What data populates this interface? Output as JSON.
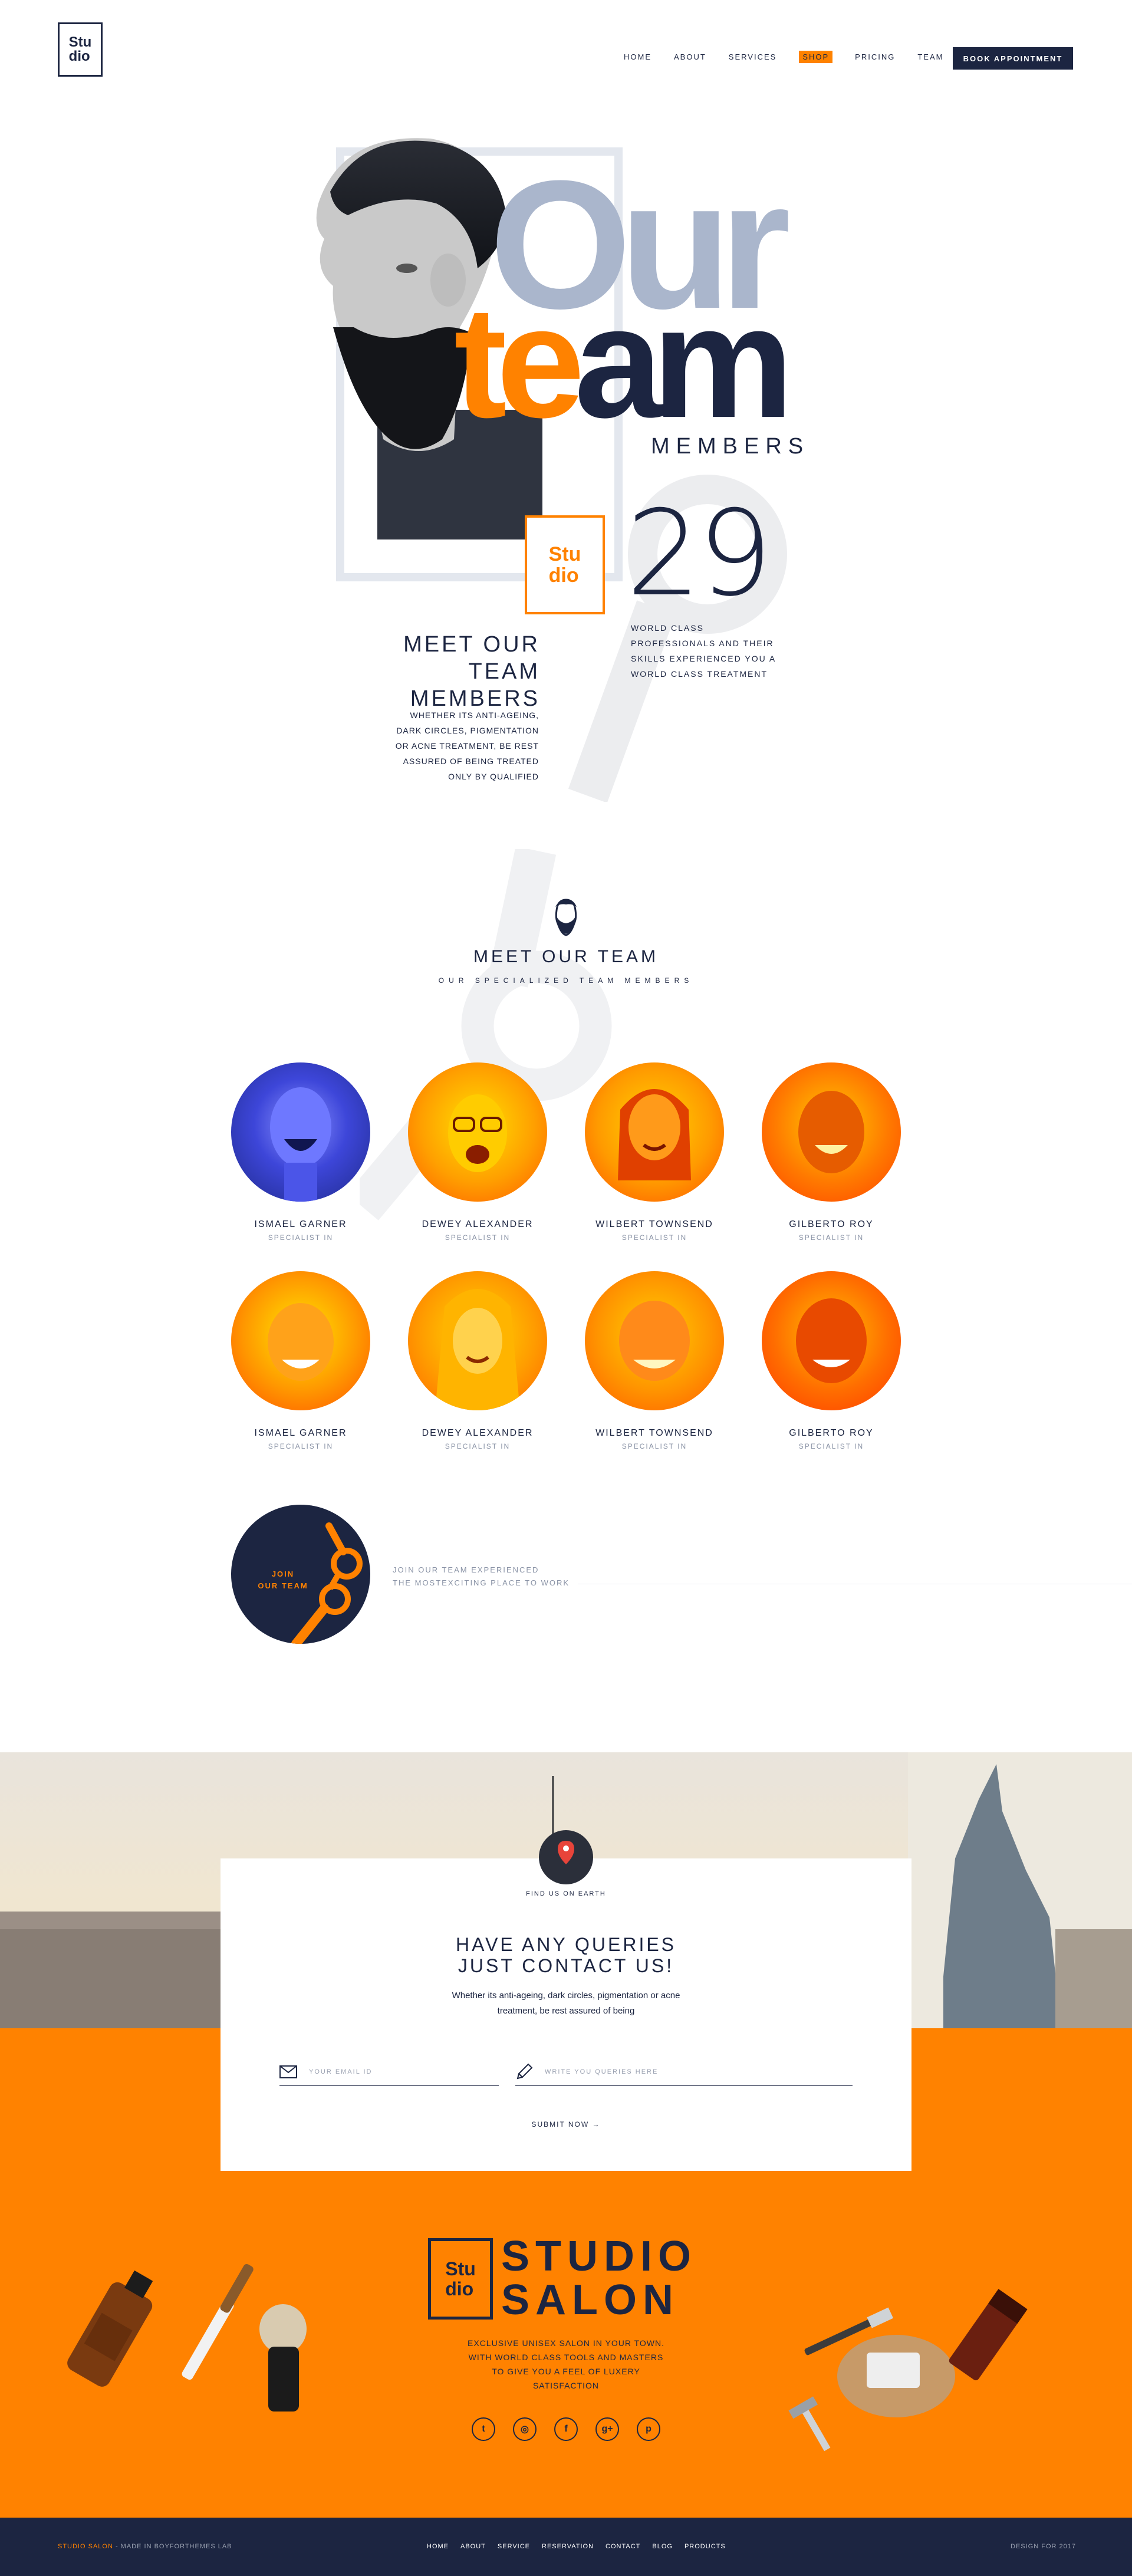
{
  "header": {
    "logo_line1": "Stu",
    "logo_line2": "dio",
    "nav": [
      "HOME",
      "ABOUT",
      "SERVICES",
      "SHOP",
      "PRICING",
      "TEAM"
    ],
    "active_nav": "SHOP",
    "cta": "BOOK APPOINTMENT"
  },
  "hero": {
    "title_top": "Our",
    "title_bottom_a": "te",
    "title_bottom_b": "am",
    "subtitle": "MEMBERS",
    "badge_line1": "Stu",
    "badge_line2": "dio",
    "count": "29",
    "count_text_1": "WORLD CLASS",
    "count_text_2": "PROFESSIONALS AND THEIR",
    "count_text_3": "SKILLS EXPERIENCED YOU A",
    "count_text_4": "WORLD CLASS TREATMENT",
    "meet_line1": "MEET OUR",
    "meet_line2": "TEAM MEMBERS",
    "desc_1": "WHETHER ITS ANTI-AGEING,",
    "desc_2": "DARK CIRCLES, PIGMENTATION",
    "desc_3": "OR ACNE TREATMENT, BE REST",
    "desc_4": "ASSURED OF BEING TREATED",
    "desc_5": "ONLY BY QUALIFIED"
  },
  "team": {
    "title": "MEET OUR TEAM",
    "subtitle": "OUR SPECIALIZED TEAM MEMBERS",
    "members": [
      {
        "name": "ISMAEL GARNER",
        "role": "SPECIALIST IN"
      },
      {
        "name": "DEWEY ALEXANDER",
        "role": "SPECIALIST IN"
      },
      {
        "name": "WILBERT TOWNSEND",
        "role": "SPECIALIST IN"
      },
      {
        "name": "GILBERTO ROY",
        "role": "SPECIALIST IN"
      },
      {
        "name": "ISMAEL GARNER",
        "role": "SPECIALIST IN"
      },
      {
        "name": "DEWEY ALEXANDER",
        "role": "SPECIALIST IN"
      },
      {
        "name": "WILBERT TOWNSEND",
        "role": "SPECIALIST IN"
      },
      {
        "name": "GILBERTO ROY",
        "role": "SPECIALIST IN"
      }
    ],
    "join_line1": "JOIN",
    "join_line2": "OUR TEAM",
    "join_text_1": "JOIN OUR TEAM EXPERIENCED",
    "join_text_2": "THE MOSTEXCITING PLACE TO WORK"
  },
  "contact": {
    "pin_label": "FIND US ON EARTH",
    "title_1": "HAVE ANY QUERIES",
    "title_2": "JUST CONTACT US!",
    "sub_1": "Whether its anti-ageing, dark circles, pigmentation or acne",
    "sub_2": "treatment, be rest assured of being",
    "email_placeholder": "YOUR EMAIL ID",
    "query_placeholder": "WRITE YOU QUERIES HERE",
    "submit": "SUBMIT NOW →"
  },
  "brand": {
    "box_line1": "Stu",
    "box_line2": "dio",
    "name_1": "STUDIO",
    "name_2": "SALON",
    "desc_1": "EXCLUSIVE UNISEX SALON IN YOUR TOWN.",
    "desc_2": "WITH WORLD CLASS TOOLS AND MASTERS",
    "desc_3": "TO GIVE YOU A FEEL OF LUXERY",
    "desc_4": "SATISFACTION",
    "social": [
      "twitter-icon",
      "dribbble-icon",
      "facebook-icon",
      "google-plus-icon",
      "pinterest-icon"
    ]
  },
  "footer": {
    "left_brand": "STUDIO SALON",
    "left_rest": " - MADE IN BOYFORTHEMES LAB",
    "nav": [
      "HOME",
      "ABOUT",
      "SERVICE",
      "RESERVATION",
      "CONTACT",
      "BLOG",
      "PRODUCTS"
    ],
    "right": "DESIGN FOR 2017"
  },
  "colors": {
    "navy": "#1c2541",
    "orange": "#ff8200",
    "gray": "#aab6cc"
  }
}
